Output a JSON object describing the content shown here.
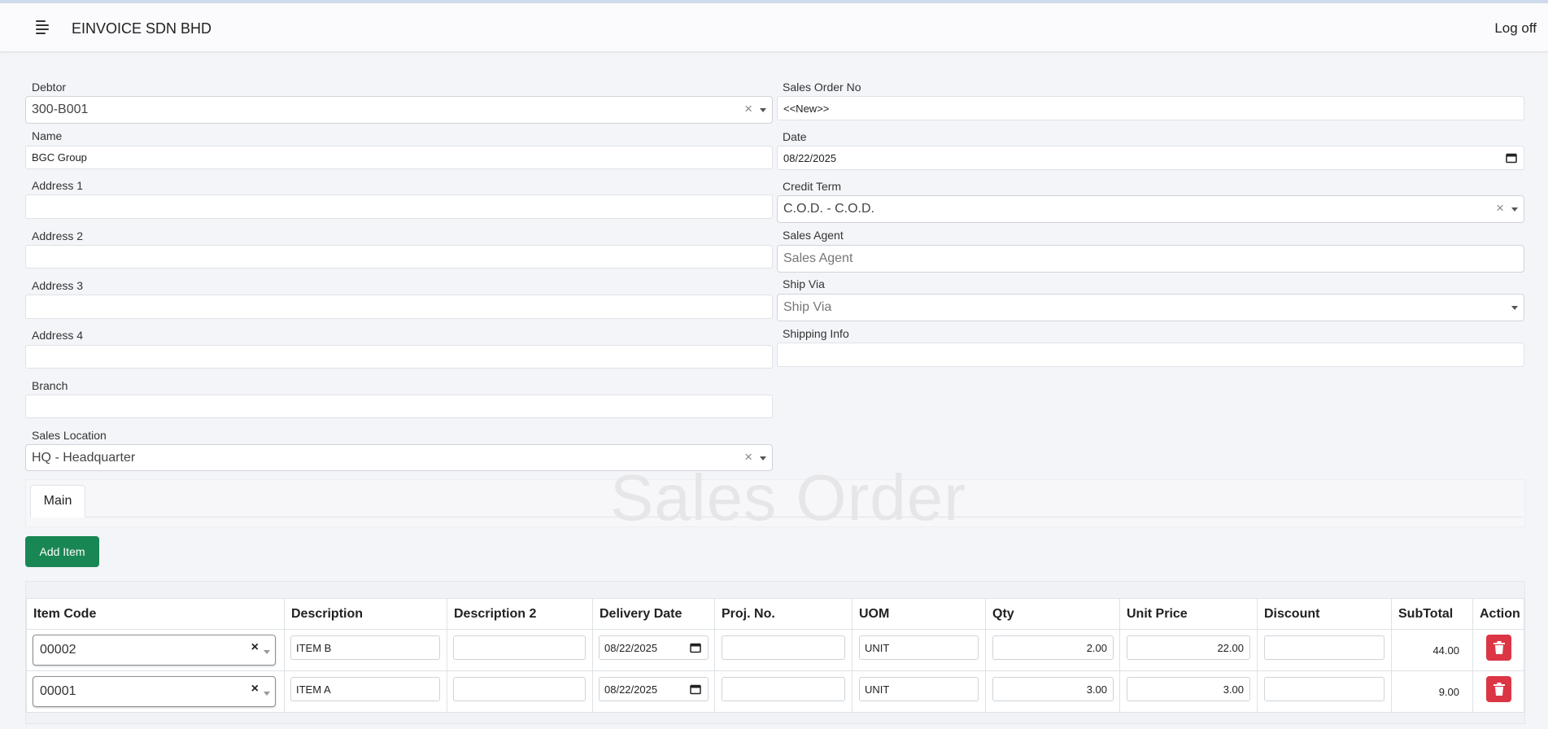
{
  "header": {
    "brand": "EINVOICE SDN BHD",
    "logoff": "Log off"
  },
  "form": {
    "debtor": {
      "label": "Debtor",
      "value": "300-B001"
    },
    "name": {
      "label": "Name",
      "value": "BGC Group"
    },
    "address1": {
      "label": "Address 1",
      "value": ""
    },
    "address2": {
      "label": "Address 2",
      "value": ""
    },
    "address3": {
      "label": "Address 3",
      "value": ""
    },
    "address4": {
      "label": "Address 4",
      "value": ""
    },
    "branch": {
      "label": "Branch",
      "value": ""
    },
    "sales_location": {
      "label": "Sales Location",
      "value": "HQ - Headquarter"
    },
    "sales_order_no": {
      "label": "Sales Order No",
      "value": "<<New>>"
    },
    "date": {
      "label": "Date",
      "value": "08/22/2025"
    },
    "credit_term": {
      "label": "Credit Term",
      "value": "C.O.D. - C.O.D."
    },
    "sales_agent": {
      "label": "Sales Agent",
      "placeholder": "Sales Agent"
    },
    "ship_via": {
      "label": "Ship Via",
      "placeholder": "Ship Via"
    },
    "shipping_info": {
      "label": "Shipping Info",
      "value": ""
    }
  },
  "tabs": {
    "main": "Main"
  },
  "watermark": "Sales Order",
  "add_item": "Add Item",
  "grid": {
    "columns": [
      "Item Code",
      "Description",
      "Description 2",
      "Delivery Date",
      "Proj. No.",
      "UOM",
      "Qty",
      "Unit Price",
      "Discount",
      "SubTotal",
      "Action"
    ],
    "rows": [
      {
        "item_code": "00002",
        "description": "ITEM B",
        "description2": "",
        "delivery_date": "08/22/2025",
        "proj_no": "",
        "uom": "UNIT",
        "qty": "2.00",
        "unit_price": "22.00",
        "discount": "",
        "subtotal": "44.00"
      },
      {
        "item_code": "00001",
        "description": "ITEM A",
        "description2": "",
        "delivery_date": "08/22/2025",
        "proj_no": "",
        "uom": "UNIT",
        "qty": "3.00",
        "unit_price": "3.00",
        "discount": "",
        "subtotal": "9.00"
      }
    ]
  },
  "colors": {
    "add_button": "#198754",
    "delete_button": "#dc3545",
    "background": "#f4f5f9"
  },
  "icons": {
    "menu": "hamburger-icon",
    "clear": "clear-icon",
    "dropdown": "chevron-down-icon",
    "calendar": "calendar-icon",
    "delete": "trash-icon"
  }
}
